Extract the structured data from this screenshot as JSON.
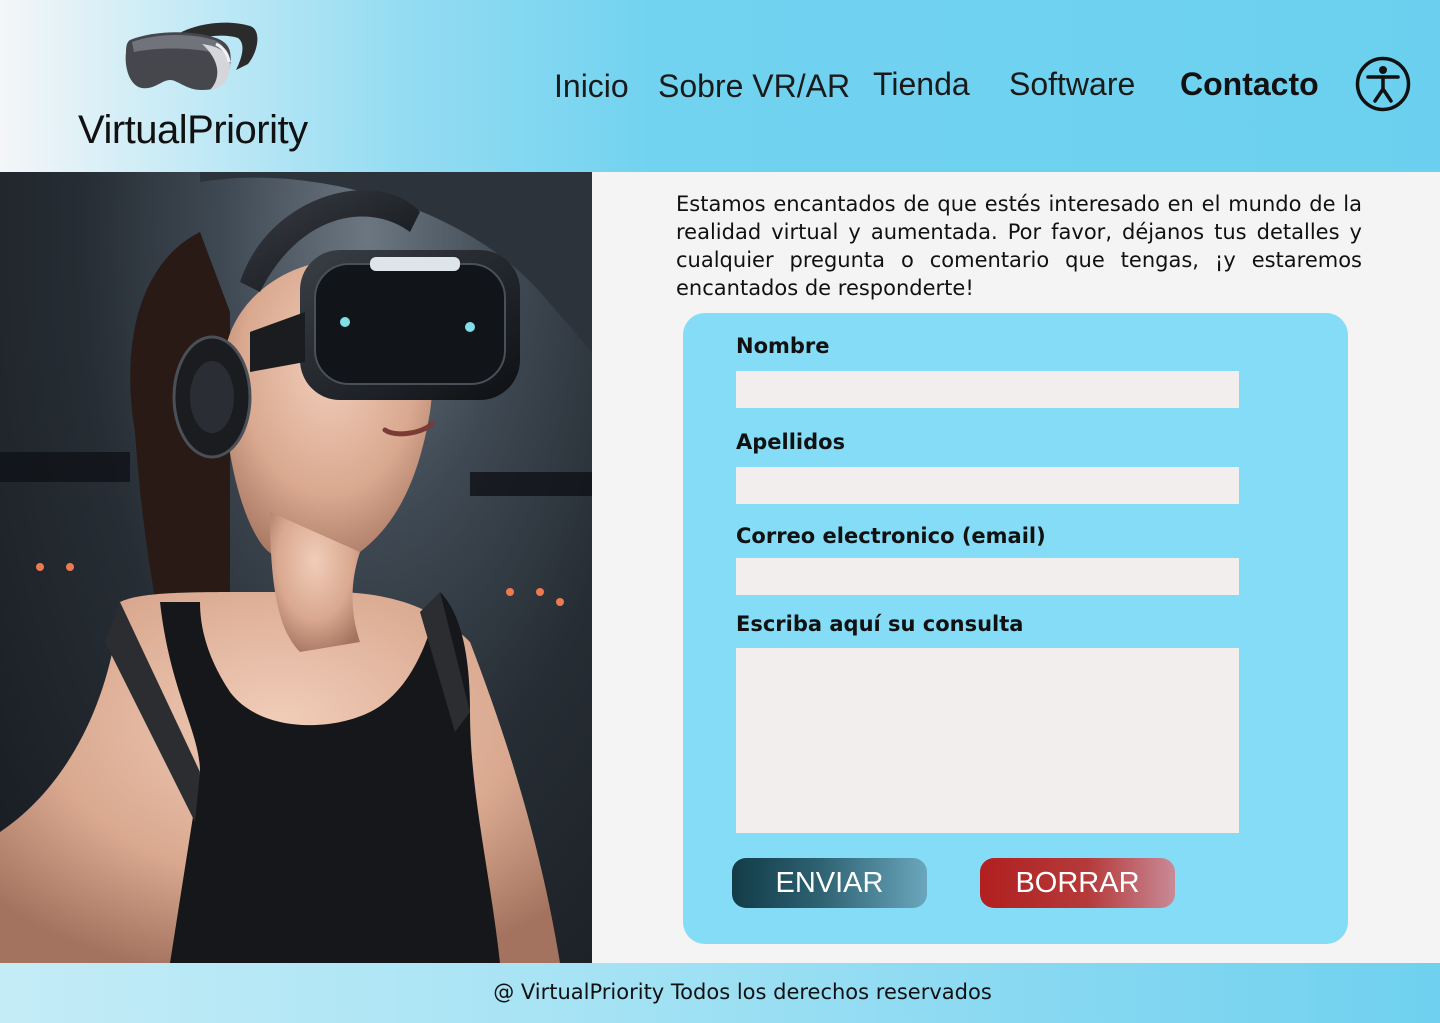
{
  "header": {
    "logo_icon": "vr-headset-icon",
    "brand": "VirtualPriority",
    "nav": [
      {
        "label": "Inicio",
        "active": false
      },
      {
        "label": "Sobre VR/AR",
        "active": false
      },
      {
        "label": "Tienda",
        "active": false
      },
      {
        "label": "Software",
        "active": false
      },
      {
        "label": "Contacto",
        "active": true
      }
    ],
    "accessibility_icon": "accessibility-icon"
  },
  "hero": {
    "image": "woman-wearing-vr-headset"
  },
  "main": {
    "intro": "Estamos encantados de que estés interesado en el mundo de la realidad virtual y aumentada. Por favor, déjanos tus detalles y cualquier pregunta o comentario que tengas, ¡y estaremos encantados de responderte!"
  },
  "form": {
    "fields": [
      {
        "label": "Nombre",
        "value": ""
      },
      {
        "label": "Apellidos",
        "value": ""
      },
      {
        "label": "Correo electronico (email)",
        "value": ""
      },
      {
        "label": "Escriba aquí su consulta",
        "value": ""
      }
    ],
    "submit_label": "ENVIAR",
    "reset_label": "BORRAR"
  },
  "footer": {
    "text": "@ VirtualPriority Todos los derechos reservados"
  },
  "colors": {
    "header_accent": "#6bd0ef",
    "form_background": "#84dcf6",
    "input_background": "#f2eeee",
    "submit_button": "#123b47",
    "reset_button": "#b21f1f",
    "page_background": "#f4f4f4"
  }
}
